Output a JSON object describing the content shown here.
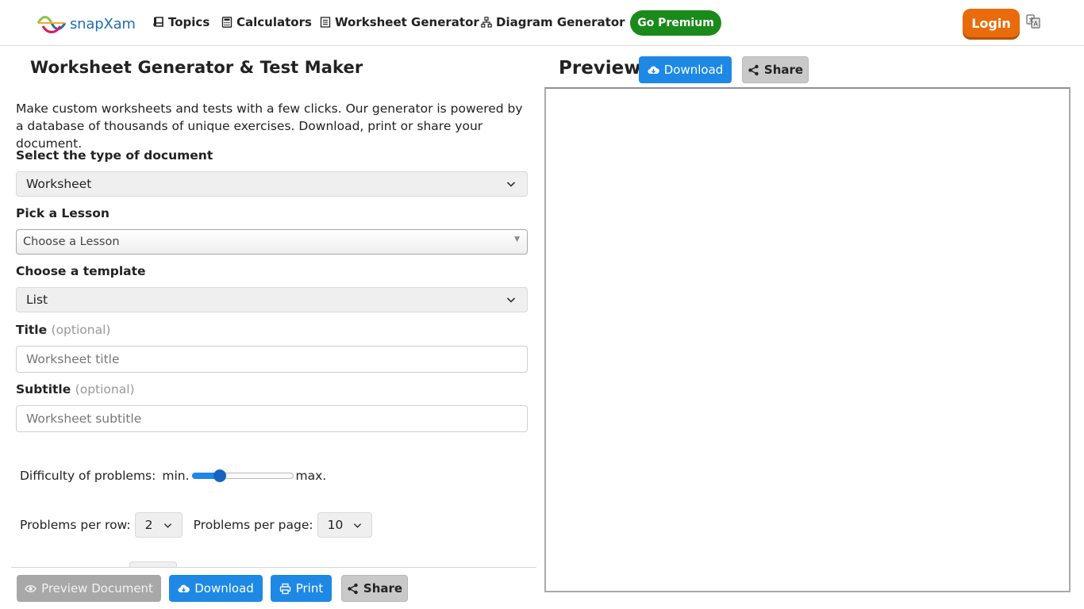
{
  "navbar": {
    "logo_text": "snapXam",
    "links": [
      {
        "label": "Topics",
        "icon": "book-icon"
      },
      {
        "label": "Calculators",
        "icon": "calculator-icon"
      },
      {
        "label": "Worksheet Generator",
        "icon": "worksheet-icon"
      },
      {
        "label": "Diagram Generator",
        "icon": "diagram-icon"
      }
    ],
    "premium_label": "Go Premium",
    "login_label": "Login",
    "translate_icon": "translate-icon"
  },
  "form": {
    "title": "Worksheet Generator & Test Maker",
    "intro": "Make custom worksheets and tests with a few clicks. Our generator is powered by a database of thousands of unique exercises. Download, print or share your document.",
    "doc_type": {
      "label": "Select the type of document",
      "value": "Worksheet"
    },
    "lesson": {
      "label": "Pick a Lesson",
      "value": "Choose a Lesson"
    },
    "template": {
      "label": "Choose a template",
      "value": "List"
    },
    "title_field": {
      "label": "Title",
      "optional": "(optional)",
      "placeholder": "Worksheet title",
      "value": ""
    },
    "subtitle_field": {
      "label": "Subtitle",
      "optional": "(optional)",
      "placeholder": "Worksheet subtitle",
      "value": ""
    },
    "difficulty": {
      "label": "Difficulty of problems:",
      "min_label": "min.",
      "max_label": "max.",
      "level": 0.27
    },
    "per_row": {
      "label": "Problems per row:",
      "value": "2"
    },
    "per_page": {
      "label": "Problems per page:",
      "value": "10"
    }
  },
  "actions": {
    "preview_label": "Preview Document",
    "download_label": "Download",
    "print_label": "Print",
    "share_label": "Share"
  },
  "preview": {
    "title": "Preview",
    "download_label": "Download",
    "share_label": "Share"
  },
  "colors": {
    "brand_blue": "#1e88e5",
    "premium_green": "#1a8a1a",
    "login_orange": "#ea6b0c"
  }
}
